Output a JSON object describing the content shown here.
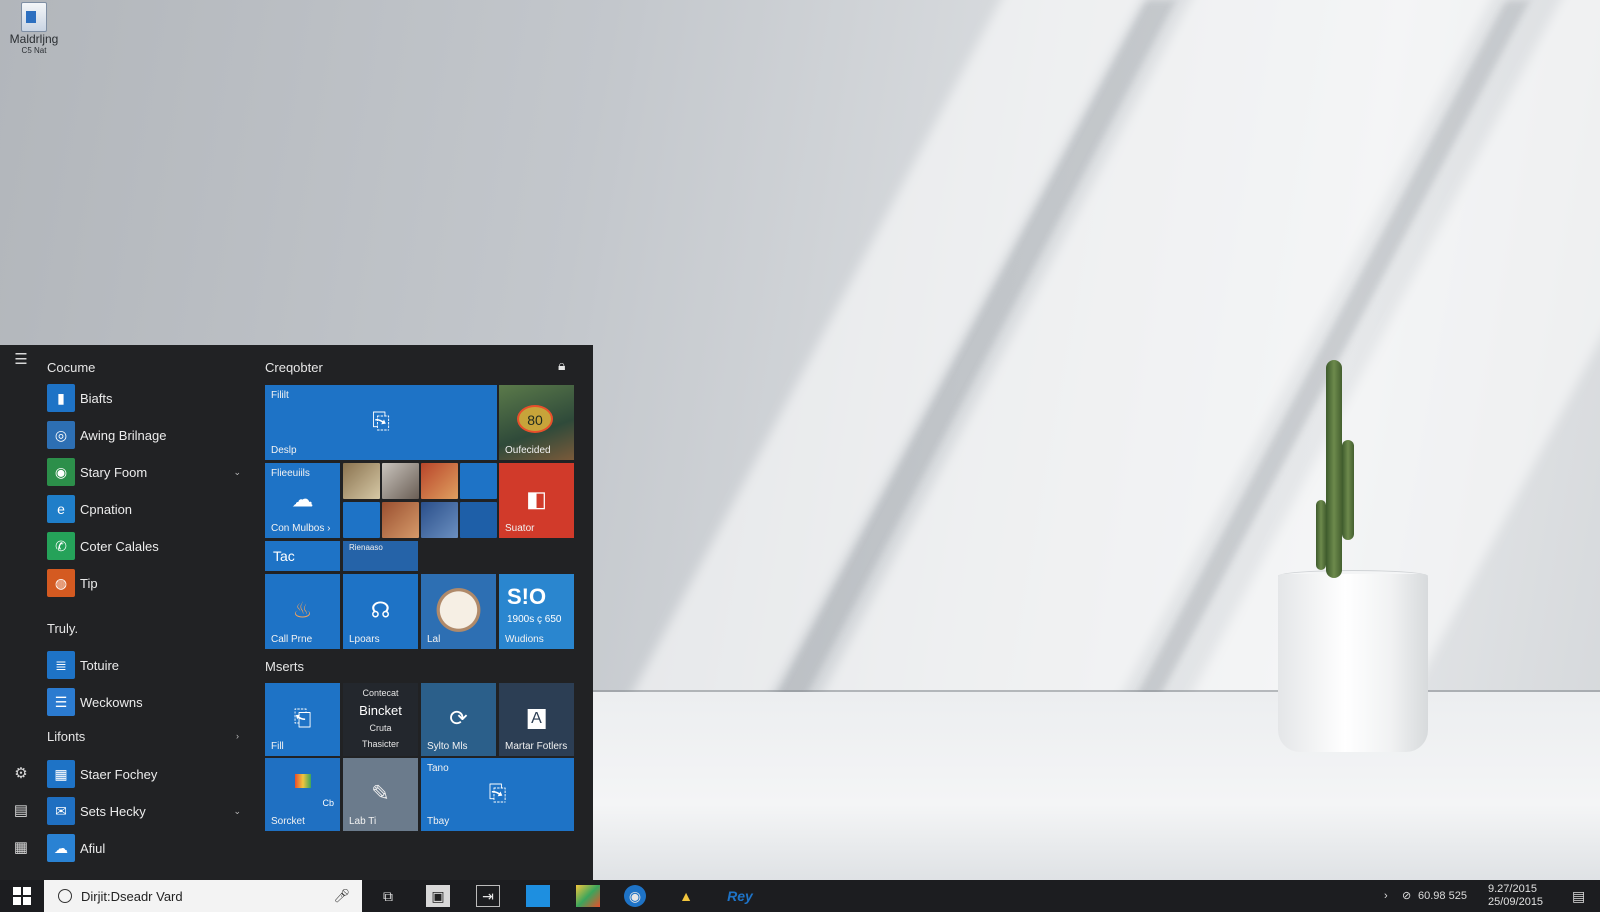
{
  "desktop": {
    "icon": {
      "label": "Maldrljng",
      "sublabel": "C5 Nat",
      "icon": "document-icon"
    }
  },
  "start_menu": {
    "list_header": "Cocume",
    "apps_group1": [
      {
        "label": "Biafts",
        "icon": "app-icon",
        "color": "#1e73c6",
        "chevron": false
      },
      {
        "label": "Awing Brilnage",
        "icon": "compass-icon",
        "color": "#2d6fb3",
        "chevron": false
      },
      {
        "label": "Stary Foom",
        "icon": "chrome-icon",
        "color": "#2c8f4a",
        "chevron": true
      },
      {
        "label": "Cpnation",
        "icon": "edge-icon",
        "color": "#1f7ec9",
        "chevron": false
      },
      {
        "label": "Coter Calales",
        "icon": "whatsapp-icon",
        "color": "#25a259",
        "chevron": false
      },
      {
        "label": "Tip",
        "icon": "firefox-icon",
        "color": "#d45a21",
        "chevron": false
      }
    ],
    "section2_header": "Truly.",
    "apps_group2": [
      {
        "label": "Totuire",
        "icon": "notepad-icon",
        "color": "#1e73c6"
      },
      {
        "label": "Weckowns",
        "icon": "document-icon",
        "color": "#2b7bd0"
      }
    ],
    "section3_header": "Lifonts",
    "apps_group3": [
      {
        "label": "Staer Fochey",
        "icon": "calendar-icon",
        "color": "#1e73c6",
        "chevron": false
      },
      {
        "label": "Sets Hecky",
        "icon": "mail-icon",
        "color": "#1f6fc1",
        "chevron": true
      },
      {
        "label": "Afiul",
        "icon": "weather-icon",
        "color": "#2a82d3",
        "chevron": false
      }
    ],
    "tiles_header": "Creqobter",
    "tiles": {
      "big_top": {
        "top": "Fililt",
        "label": "Deslp"
      },
      "photo_tile": {
        "badge": "80",
        "label": "Oufecided"
      },
      "onedrive": {
        "top": "Flieeuiils",
        "label": "Con Mulbos ›"
      },
      "office": {
        "label": "Suator"
      },
      "wide_small": {
        "label": "Tac"
      },
      "wide_small2": {
        "label": "Rienaaso"
      },
      "call": {
        "label": "Call Prne"
      },
      "lapads": {
        "label": "Lpoars"
      },
      "lal": {
        "label": "Lal"
      },
      "store": {
        "big": "S!O",
        "sub": "1900s ç 650",
        "label": "Wudions"
      }
    },
    "tiles_section2_header": "Mserts",
    "tiles2": {
      "files": {
        "label": "Fill"
      },
      "contact": {
        "line1": "Contecat",
        "line2": "Bincket",
        "line3": "Cruta",
        "line4": "Thasicter"
      },
      "sync": {
        "label": "Sylto Mls"
      },
      "master": {
        "label": "Martar Fotlers"
      },
      "paint": {
        "label": "Sorcket",
        "corner": "Cb"
      },
      "lab": {
        "label": "Lab Ti"
      },
      "tray_tile": {
        "top": "Tano",
        "label": "Tbay"
      }
    }
  },
  "taskbar": {
    "search_placeholder": "Dirjit:Dseadr Vard",
    "tray_network": "60.98 525",
    "clock_time": "9.27/2015",
    "clock_date": "25/09/2015",
    "pinned": [
      "task-view-icon",
      "photos-icon",
      "window-icon",
      "file-explorer-icon",
      "image-icon",
      "circle-app-icon",
      "drive-icon",
      "text-app-icon"
    ],
    "pinned_text": "Rey"
  }
}
